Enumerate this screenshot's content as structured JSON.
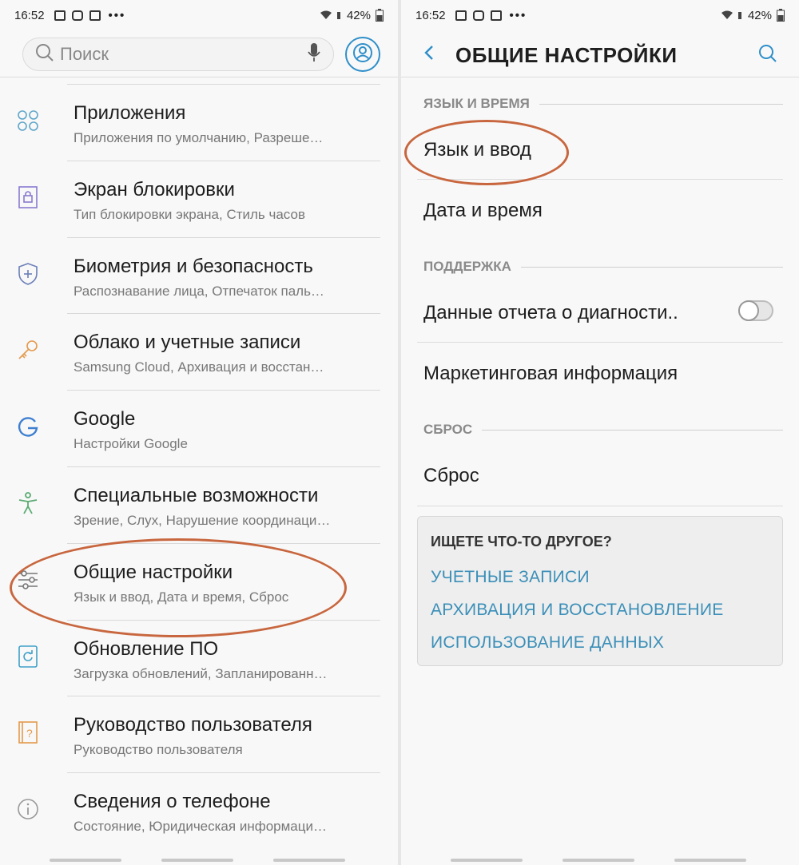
{
  "status": {
    "time": "16:52",
    "battery": "42%"
  },
  "left": {
    "search": {
      "placeholder": "Поиск"
    },
    "menu": [
      {
        "title": "Приложения",
        "subtitle": "Приложения по умолчанию, Разреше…",
        "icon": "apps-icon"
      },
      {
        "title": "Экран блокировки",
        "subtitle": "Тип блокировки экрана, Стиль часов",
        "icon": "lock-icon"
      },
      {
        "title": "Биометрия и безопасность",
        "subtitle": "Распознавание лица, Отпечаток паль…",
        "icon": "shield-icon"
      },
      {
        "title": "Облако и учетные записи",
        "subtitle": "Samsung Cloud, Архивация и восстан…",
        "icon": "key-icon"
      },
      {
        "title": "Google",
        "subtitle": "Настройки Google",
        "icon": "google-icon"
      },
      {
        "title": "Специальные возможности",
        "subtitle": "Зрение, Слух, Нарушение координаци…",
        "icon": "accessibility-icon"
      },
      {
        "title": "Общие настройки",
        "subtitle": "Язык и ввод, Дата и время, Сброс",
        "icon": "sliders-icon"
      },
      {
        "title": "Обновление ПО",
        "subtitle": "Загрузка обновлений, Запланированн…",
        "icon": "update-icon"
      },
      {
        "title": "Руководство пользователя",
        "subtitle": "Руководство пользователя",
        "icon": "help-book-icon"
      },
      {
        "title": "Сведения о телефоне",
        "subtitle": "Состояние, Юридическая информаци…",
        "icon": "info-icon"
      }
    ]
  },
  "right": {
    "title": "ОБЩИЕ НАСТРОЙКИ",
    "sections": {
      "lang_time": "ЯЗЫК И ВРЕМЯ",
      "support": "ПОДДЕРЖКА",
      "reset": "СБРОС"
    },
    "items": {
      "language_input": "Язык и ввод",
      "date_time": "Дата и время",
      "diagnostics": "Данные отчета о диагности..",
      "marketing": "Маркетинговая информация",
      "reset": "Сброс"
    },
    "diagnostics_enabled": false,
    "card": {
      "heading": "ИЩЕТЕ ЧТО-ТО ДРУГОЕ?",
      "links": [
        "УЧЕТНЫЕ ЗАПИСИ",
        "АРХИВАЦИЯ И ВОССТАНОВЛЕНИЕ",
        "ИСПОЛЬЗОВАНИЕ ДАННЫХ"
      ]
    }
  },
  "colors": {
    "accent": "#2f8fc9",
    "link": "#3b8fb8",
    "highlight": "#c8673f",
    "icon": "#5fa6c9"
  }
}
